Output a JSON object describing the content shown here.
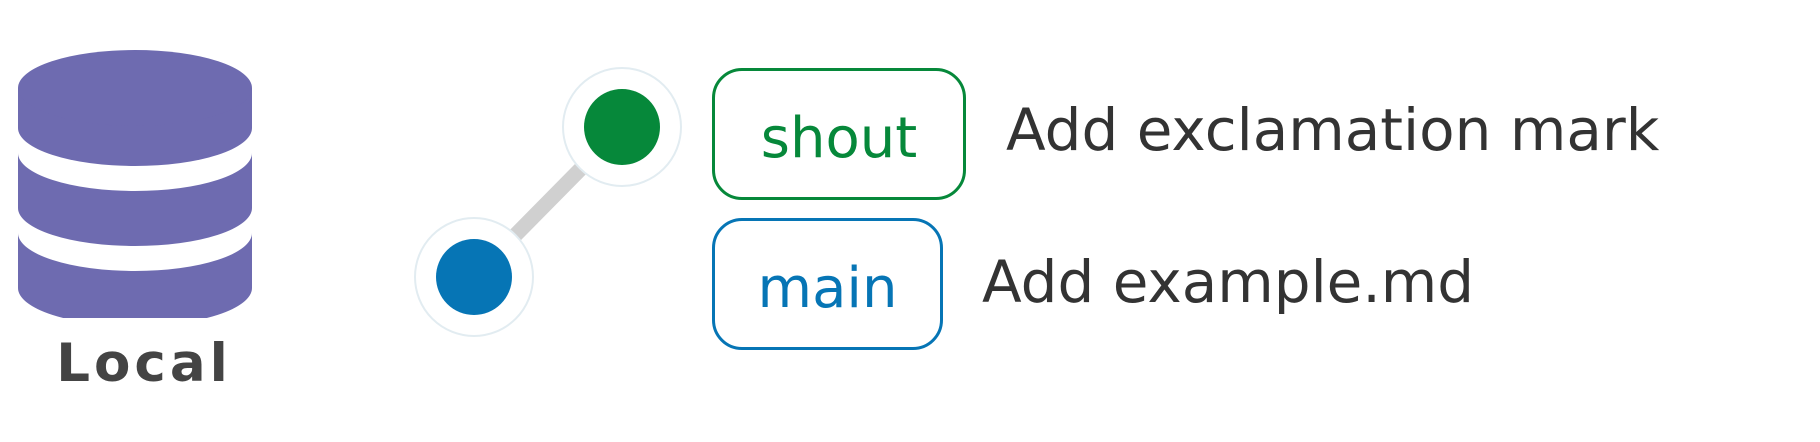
{
  "repository": {
    "label": "Local",
    "icon": "database-icon",
    "color": "#6e6bb0"
  },
  "commits": [
    {
      "branch": "shout",
      "message": "Add exclamation mark",
      "color": "#06883a"
    },
    {
      "branch": "main",
      "message": "Add example.md",
      "color": "#0675b5"
    }
  ],
  "edge_color": "#d0d0d0"
}
